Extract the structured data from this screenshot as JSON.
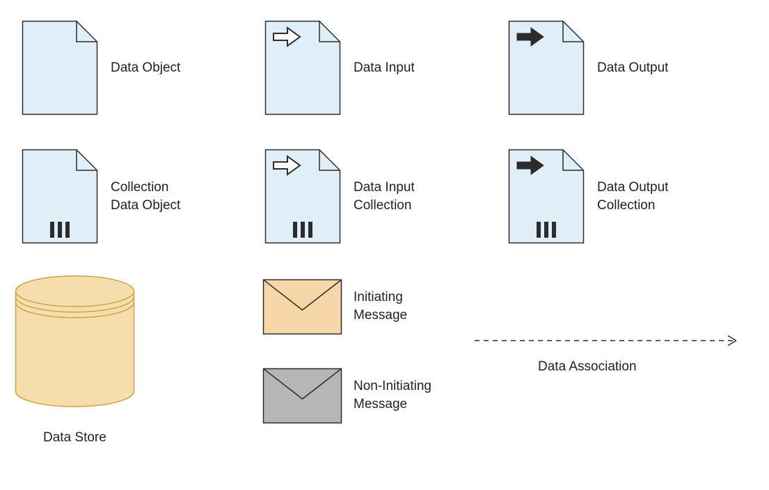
{
  "labels": {
    "data_object": "Data Object",
    "data_input": "Data Input",
    "data_output": "Data Output",
    "collection_data_object_l1": "Collection",
    "collection_data_object_l2": "Data Object",
    "data_input_collection_l1": "Data Input",
    "data_input_collection_l2": "Collection",
    "data_output_collection_l1": "Data Output",
    "data_output_collection_l2": "Collection",
    "initiating_message_l1": "Initiating",
    "initiating_message_l2": "Message",
    "non_initiating_message_l1": "Non-Initiating",
    "non_initiating_message_l2": "Message",
    "data_store": "Data Store",
    "data_association": "Data Association"
  },
  "colors": {
    "doc_fill": "#e0eef8",
    "doc_stroke": "#2c2c2c",
    "store_fill": "#f5deab",
    "store_stroke": "#c9a24a",
    "env_init_fill": "#f7d7a7",
    "env_noninit_fill": "#b6b6b6",
    "env_stroke": "#2c2c2c",
    "arrow_fill_light": "#ffffff",
    "arrow_fill_dark": "#2c2c2c",
    "dash_stroke": "#2c2c2c"
  },
  "shapes": [
    {
      "name": "data-object",
      "type": "doc",
      "arrow": "none",
      "collection": false,
      "label_key": "data_object"
    },
    {
      "name": "data-input",
      "type": "doc",
      "arrow": "open",
      "collection": false,
      "label_key": "data_input"
    },
    {
      "name": "data-output",
      "type": "doc",
      "arrow": "solid",
      "collection": false,
      "label_key": "data_output"
    },
    {
      "name": "collection-data-object",
      "type": "doc",
      "arrow": "none",
      "collection": true,
      "label_key": "collection_data_object"
    },
    {
      "name": "data-input-collection",
      "type": "doc",
      "arrow": "open",
      "collection": true,
      "label_key": "data_input_collection"
    },
    {
      "name": "data-output-collection",
      "type": "doc",
      "arrow": "solid",
      "collection": true,
      "label_key": "data_output_collection"
    },
    {
      "name": "data-store",
      "type": "store",
      "label_key": "data_store"
    },
    {
      "name": "initiating-message",
      "type": "envelope",
      "variant": "initiating",
      "label_key": "initiating_message"
    },
    {
      "name": "non-initiating-message",
      "type": "envelope",
      "variant": "non_initiating",
      "label_key": "non_initiating_message"
    },
    {
      "name": "data-association",
      "type": "dashed_arrow",
      "label_key": "data_association"
    }
  ]
}
